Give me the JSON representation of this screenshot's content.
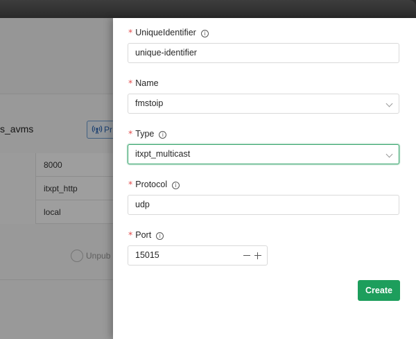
{
  "background": {
    "card_title": "s_avms",
    "publish_button": "Pr",
    "table_rows": [
      {
        "value": "8000"
      },
      {
        "value": "itxpt_http"
      },
      {
        "value": "local"
      }
    ],
    "unpublish_label": "Unpub"
  },
  "form": {
    "unique_identifier": {
      "label": "UniqueIdentifier",
      "required": "*",
      "value": "unique-identifier"
    },
    "name": {
      "label": "Name",
      "required": "*",
      "value": "fmstoip"
    },
    "type": {
      "label": "Type",
      "required": "*",
      "value": "itxpt_multicast"
    },
    "protocol": {
      "label": "Protocol",
      "required": "*",
      "value": "udp"
    },
    "port": {
      "label": "Port",
      "required": "*",
      "value": "15015"
    },
    "info_glyph": "i",
    "create_label": "Create"
  },
  "colors": {
    "primary": "#1d9e5c",
    "required": "#e34d4d",
    "focus_border": "#35a36a"
  }
}
